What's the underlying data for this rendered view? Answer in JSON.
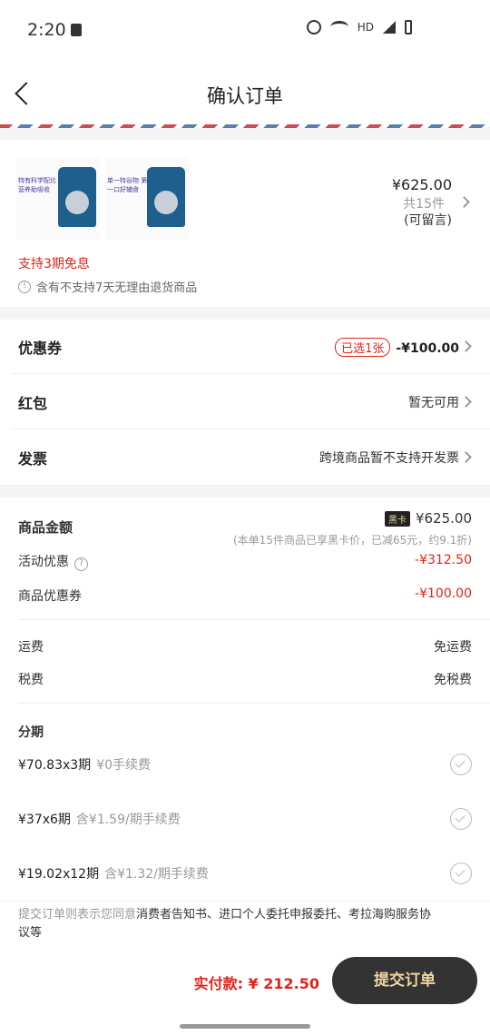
{
  "status_bar": {
    "time": "2:20",
    "network": "HD"
  },
  "header": {
    "title": "确认订单"
  },
  "product": {
    "thumb1_text": "特有科学配比 营养助吸收",
    "thumb2_text": "单一特谷物 第一口好辅食",
    "price": "¥625.00",
    "quantity": "共15件",
    "message": "(可留言)",
    "installment_note": "支持3期免息",
    "return_note": "含有不支持7天无理由退货商品"
  },
  "options": {
    "coupon": {
      "label": "优惠券",
      "badge": "已选1张",
      "value": "-¥100.00"
    },
    "red_packet": {
      "label": "红包",
      "value": "暂无可用"
    },
    "invoice": {
      "label": "发票",
      "value": "跨境商品暂不支持开发票"
    }
  },
  "summary": {
    "goods_amount_label": "商品金额",
    "black_card": "黑卡",
    "goods_amount": "¥625.00",
    "goods_note": "(本单15件商品已享黑卡价，已减65元，约9.1折)",
    "activity_label": "活动优惠",
    "activity_value": "-¥312.50",
    "coupon_label": "商品优惠券",
    "coupon_value": "-¥100.00",
    "shipping_label": "运费",
    "shipping_value": "免运费",
    "tax_label": "税费",
    "tax_value": "免税费"
  },
  "installments": {
    "title": "分期",
    "plans": [
      {
        "price": "¥70.83x3期",
        "fee": "¥0手续费"
      },
      {
        "price": "¥37x6期",
        "fee": "含¥1.59/期手续费"
      },
      {
        "price": "¥19.02x12期",
        "fee": "含¥1.32/期手续费"
      }
    ]
  },
  "agreement": {
    "prefix": "提交订单则表示您同意",
    "links": "消费者告知书、进口个人委托申报委托、考拉海购服务协议等"
  },
  "footer": {
    "pay_label": "实付款: ¥ 212.50",
    "submit": "提交订单"
  }
}
